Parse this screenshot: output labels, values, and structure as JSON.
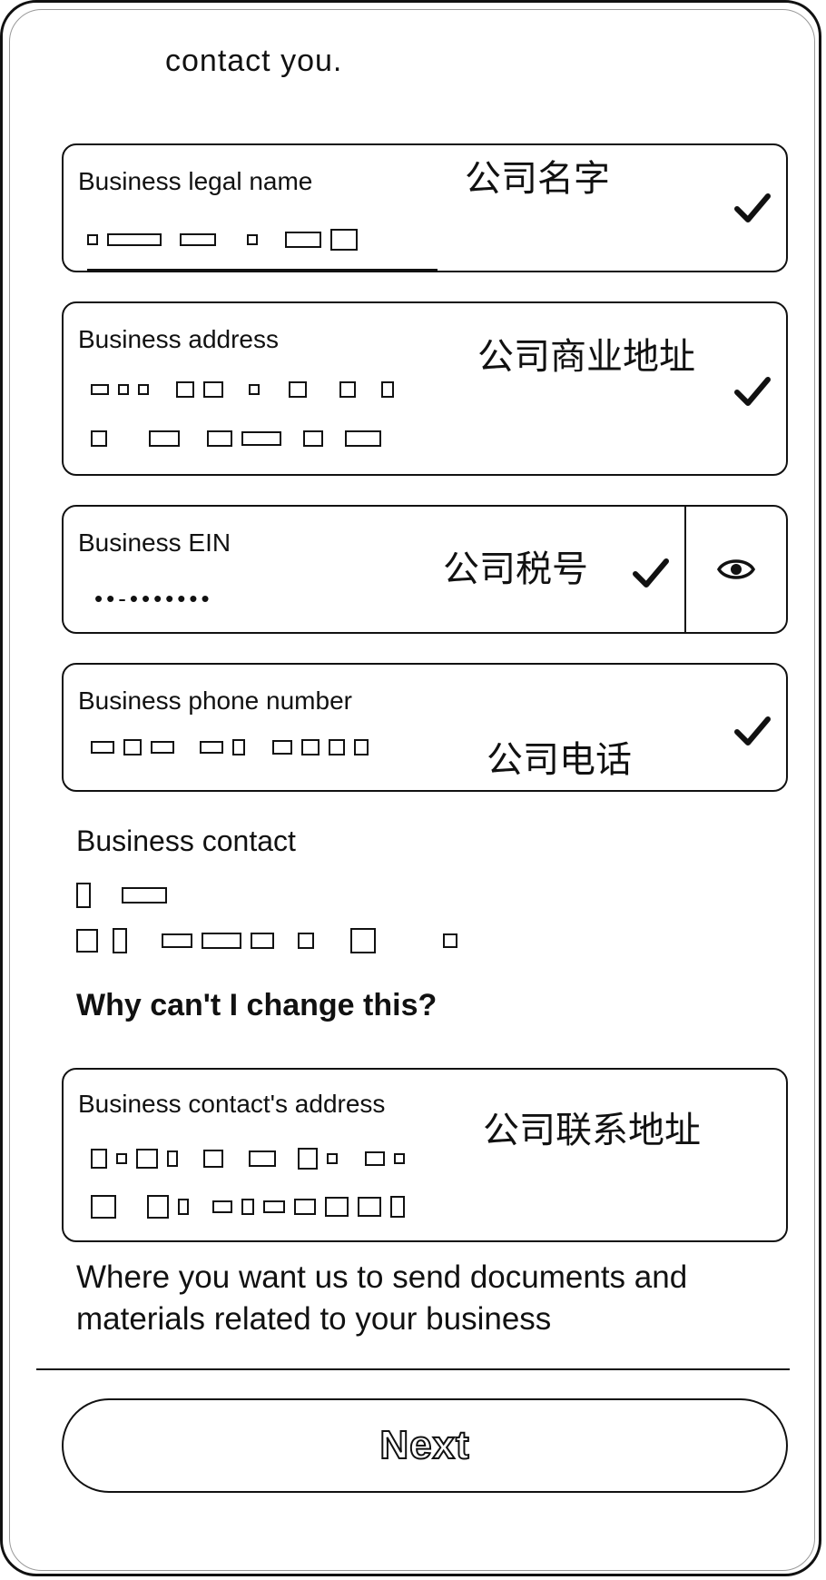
{
  "intro": {
    "text": "contact you."
  },
  "fields": {
    "legal_name": {
      "label": "Business legal name",
      "annotation": "公司名字"
    },
    "address": {
      "label": "Business address",
      "annotation": "公司商业地址"
    },
    "ein": {
      "label": "Business EIN",
      "annotation": "公司税号",
      "value": "••-•••••••",
      "reveal_icon": "eye-icon"
    },
    "phone": {
      "label": "Business phone number",
      "annotation": "公司电话"
    },
    "contact_address": {
      "label": "Business contact's address",
      "annotation": "公司联系地址"
    }
  },
  "contact": {
    "label": "Business contact",
    "why_link": "Why can't I change this?"
  },
  "note": "Where you want us to send documents and materials related to your business",
  "next_button": {
    "label": "Next"
  },
  "icons": {
    "check": "check-icon",
    "eye": "eye-icon"
  }
}
